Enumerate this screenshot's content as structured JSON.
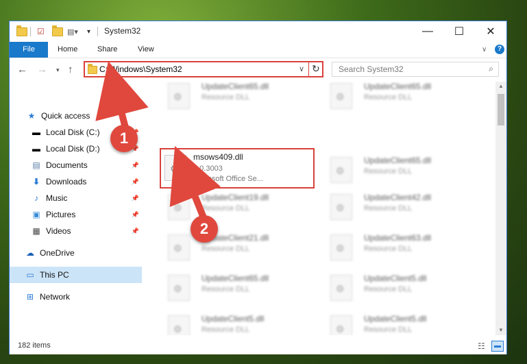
{
  "window": {
    "title": "System32"
  },
  "ribbon": {
    "tabs": [
      "File",
      "Home",
      "Share",
      "View"
    ]
  },
  "address": {
    "path": "C:\\Windows\\System32"
  },
  "search": {
    "placeholder": "Search System32"
  },
  "sidebar": {
    "items": [
      {
        "label": "Quick access",
        "icon": "star-icon"
      },
      {
        "label": "Local Disk (C:)",
        "icon": "drive-icon",
        "pinned": true
      },
      {
        "label": "Local Disk (D:)",
        "icon": "drive-icon",
        "pinned": true
      },
      {
        "label": "Documents",
        "icon": "document-icon",
        "pinned": true
      },
      {
        "label": "Downloads",
        "icon": "download-icon",
        "pinned": true
      },
      {
        "label": "Music",
        "icon": "music-icon",
        "pinned": true
      },
      {
        "label": "Pictures",
        "icon": "picture-icon",
        "pinned": true
      },
      {
        "label": "Videos",
        "icon": "video-icon",
        "pinned": true
      },
      {
        "label": "OneDrive",
        "icon": "cloud-icon"
      },
      {
        "label": "This PC",
        "icon": "computer-icon",
        "selected": true
      },
      {
        "label": "Network",
        "icon": "network-icon"
      }
    ]
  },
  "files": [
    {
      "name": "UpdateClient65.dll",
      "type": "Resource DLL"
    },
    {
      "name": "UpdateClient65.dll",
      "type": "Resource DLL"
    },
    {
      "name": "msows409.dll",
      "version": "9.0.3003",
      "type": "Microsoft Office Se..."
    },
    {
      "name": "UpdateClient65.dll",
      "type": "Resource DLL"
    },
    {
      "name": "UpdateClient19.dll",
      "type": "Resource DLL"
    },
    {
      "name": "UpdateClient42.dll",
      "type": "Resource DLL"
    },
    {
      "name": "UpdateClient21.dll",
      "type": "Resource DLL"
    },
    {
      "name": "UpdateClient63.dll",
      "type": "Resource DLL"
    },
    {
      "name": "UpdateClient65.dll",
      "type": "Resource DLL"
    },
    {
      "name": "UpdateClient5.dll",
      "type": "Resource DLL"
    },
    {
      "name": "UpdateClient5.dll",
      "type": "Resource DLL"
    },
    {
      "name": "UpdateClient5.dll",
      "type": "Resource DLL"
    }
  ],
  "status": {
    "count": "182 items"
  },
  "annotations": {
    "step1": "1",
    "step2": "2"
  },
  "colors": {
    "accent": "#1979ca",
    "highlight": "#d9403a"
  }
}
